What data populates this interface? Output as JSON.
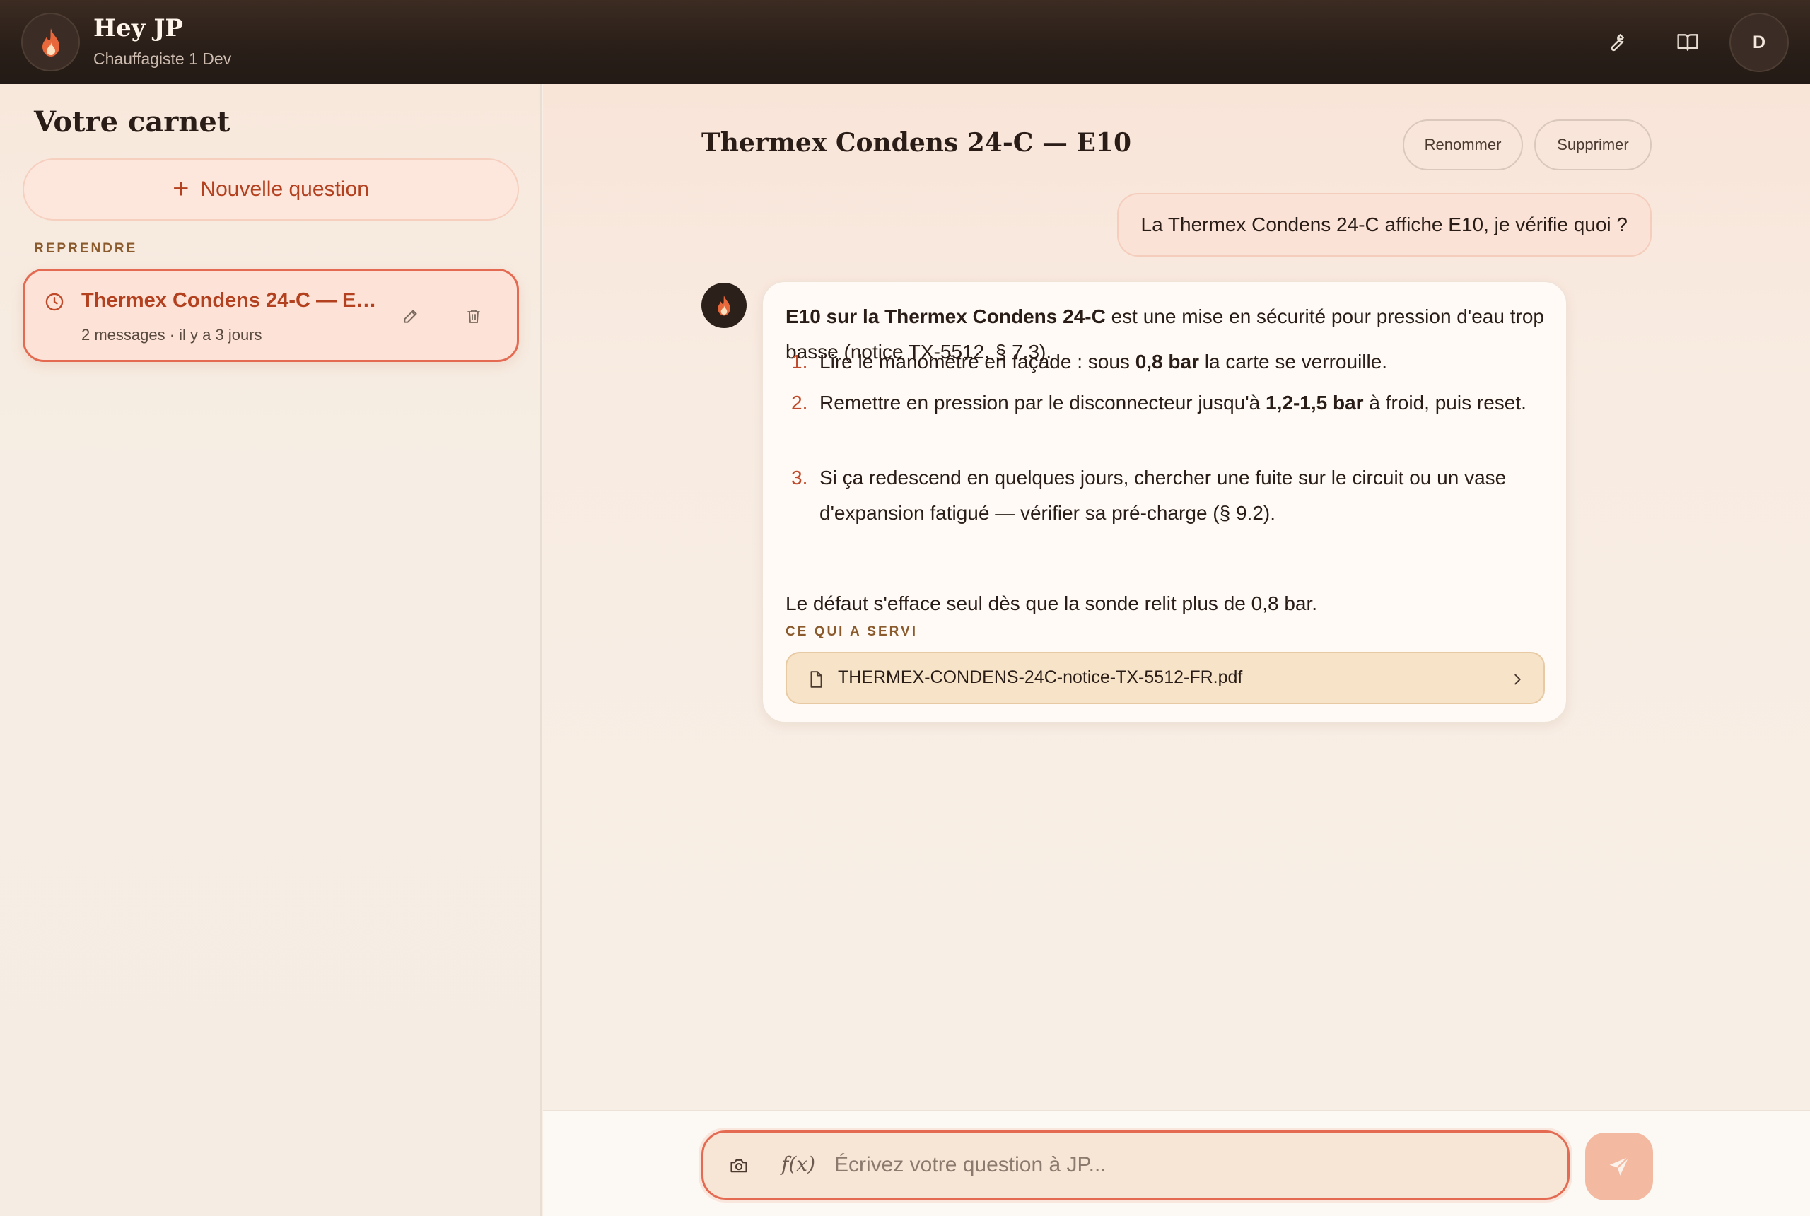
{
  "header": {
    "title": "Hey JP",
    "subtitle": "Chauffagiste 1 Dev",
    "avatar_letter": "D",
    "icons": [
      "flame-icon",
      "wrench-icon",
      "book-icon"
    ]
  },
  "sidebar": {
    "title": "Votre carnet",
    "new_button_label": "Nouvelle question",
    "section_label": "REPRENDRE",
    "conversations": [
      {
        "title": "Thermex Condens 24-C — E10",
        "meta": "2 messages · il y a 3 jours",
        "active": true
      }
    ]
  },
  "main": {
    "title": "Thermex Condens 24-C — E10",
    "rename_label": "Renommer",
    "delete_label": "Supprimer",
    "user_message": "La Thermex Condens 24-C affiche E10, je vérifie quoi ?",
    "assistant": {
      "intro_bold": "E10 sur la Thermex Condens 24-C",
      "intro_rest": " est une mise en sécurité pour pression d'eau trop basse (notice TX-5512, § 7.3).",
      "steps": [
        {
          "num": "1.",
          "pre": "Lire le manomètre en façade : sous ",
          "bold": "0,8 bar",
          "post": " la carte se verrouille."
        },
        {
          "num": "2.",
          "pre": "Remettre en pression par le disconnecteur jusqu'à ",
          "bold": "1,2-1,5 bar",
          "post": " à froid, puis reset."
        },
        {
          "num": "3.",
          "pre": "Si ça redescend en quelques jours, chercher une fuite sur le circuit ou un vase d'expansion fatigué — vérifier sa pré-charge (§ 9.2).",
          "bold": "",
          "post": ""
        }
      ],
      "closing": "Le défaut s'efface seul dès que la sonde relit plus de 0,8 bar.",
      "sources_label": "CE QUI A SERVI",
      "source_file": "THERMEX-CONDENS-24C-notice-TX-5512-FR.pdf"
    }
  },
  "composer": {
    "placeholder": "Écrivez votre question à JP...",
    "fx_label": "f(x)"
  },
  "colors": {
    "accent": "#e56a52",
    "accent_text": "#b3401e",
    "header_bg": "#2a1f19",
    "label_brown": "#8a5a2c"
  }
}
